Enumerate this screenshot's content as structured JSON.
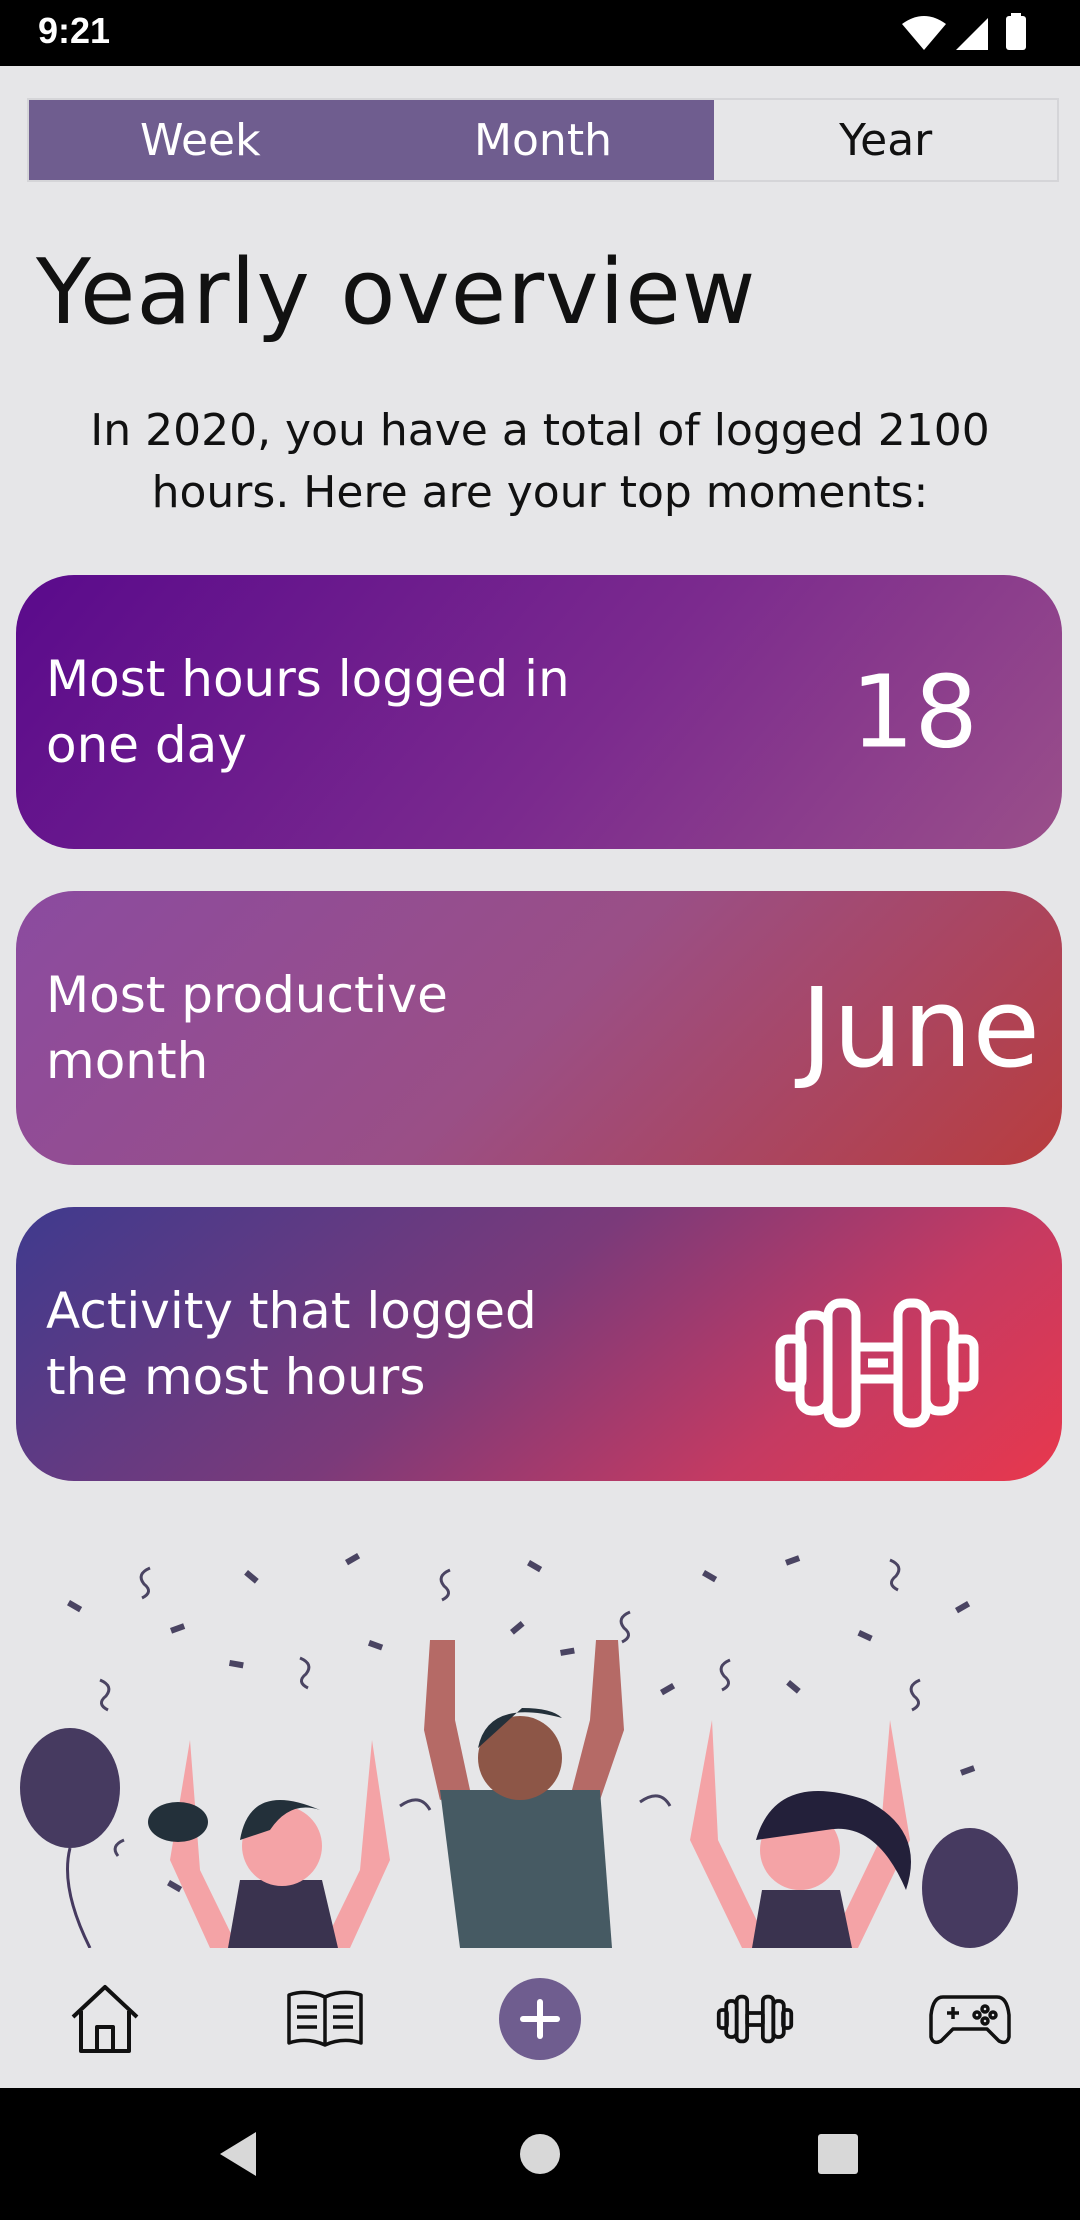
{
  "status_bar": {
    "time": "9:21"
  },
  "period_tabs": [
    {
      "label": "Week",
      "active": true
    },
    {
      "label": "Month",
      "active": true
    },
    {
      "label": "Year",
      "active": false
    }
  ],
  "page": {
    "title": "Yearly overview",
    "intro": "In 2020, you have a total of logged 2100 hours. Here are your top moments:"
  },
  "cards": [
    {
      "label": "Most hours logged in one day",
      "value": "18"
    },
    {
      "label": "Most productive month",
      "value": "June"
    },
    {
      "label": "Activity that logged the most hours",
      "icon": "dumbbell-icon"
    }
  ],
  "bottom_nav": [
    {
      "icon": "home-icon"
    },
    {
      "icon": "book-icon"
    },
    {
      "icon": "add-icon"
    },
    {
      "icon": "dumbbell-icon"
    },
    {
      "icon": "gamepad-icon"
    }
  ],
  "colors": {
    "accent": "#6f5d8f",
    "background": "#e6e6e8"
  }
}
